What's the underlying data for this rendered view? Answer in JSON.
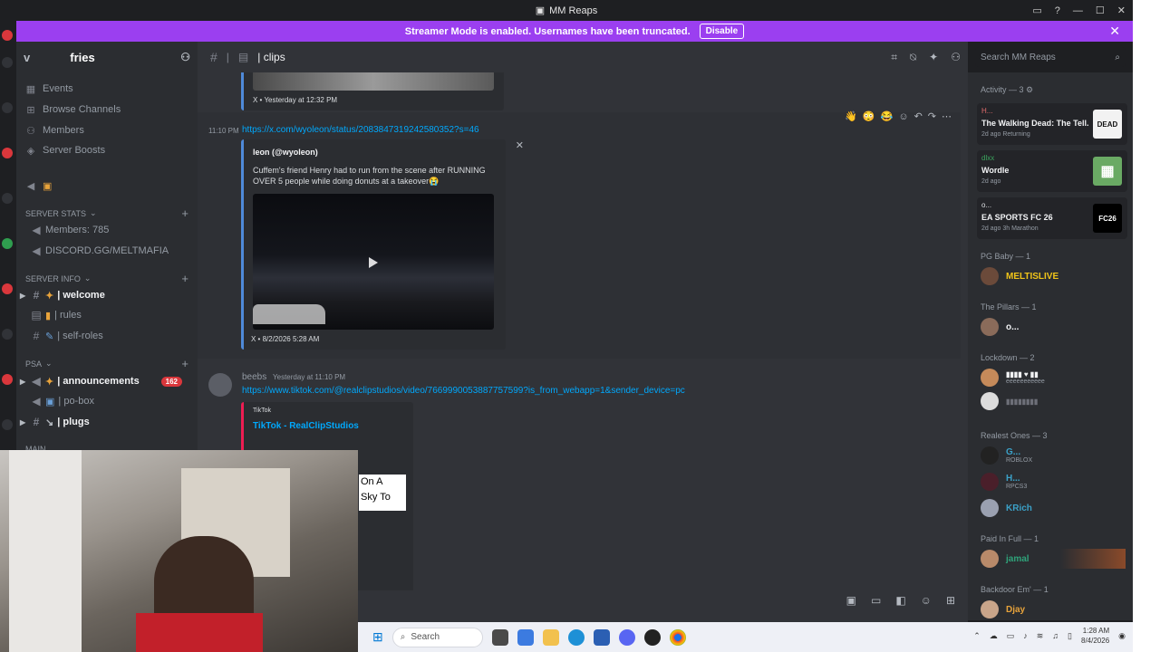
{
  "window": {
    "title": "MM Reaps"
  },
  "banner": {
    "text": "Streamer Mode is enabled. Usernames have been truncated.",
    "button": "Disable"
  },
  "server": {
    "name": "fries",
    "name_prefix": "v"
  },
  "sidebar": {
    "top_items": [
      {
        "label": "Events",
        "icon": "calendar-icon"
      },
      {
        "label": "Browse Channels",
        "icon": "browse-icon"
      },
      {
        "label": "Members",
        "icon": "members-icon"
      },
      {
        "label": "Server Boosts",
        "icon": "boost-icon"
      }
    ],
    "categories": [
      {
        "label": "SERVER STATS",
        "channels": [
          {
            "label": "Members: 785"
          },
          {
            "label": "DISCORD.GG/MELTMAFIA"
          }
        ]
      },
      {
        "label": "SERVER INFO",
        "channels": [
          {
            "label": "| welcome",
            "bright": true
          },
          {
            "label": "| rules"
          },
          {
            "label": "| self-roles"
          }
        ]
      },
      {
        "label": "PSA",
        "channels": [
          {
            "label": "| announcements",
            "bright": true,
            "badge": "162"
          },
          {
            "label": "| po-box"
          },
          {
            "label": "| plugs",
            "bright": true
          }
        ]
      },
      {
        "label": "MAIN"
      }
    ]
  },
  "channel": {
    "name": "| clips"
  },
  "search": {
    "placeholder": "Search MM Reaps"
  },
  "messages": [
    {
      "embed_footer": "X • Yesterday at 12:32 PM"
    },
    {
      "time": "11:10 PM",
      "link": "https://x.com/wyoleon/status/2083847319242580352?s=46",
      "author": "leon (@wyoleon)",
      "text": "Cuffem's friend Henry had to run from the scene after RUNNING OVER 5 people while doing donuts at a takeover😭",
      "embed_footer": "X • 8/2/2026 5:28 AM"
    },
    {
      "user": "beebs",
      "time": "Yesterday at 11:10 PM",
      "link": "https://www.tiktok.com/@realclipstudios/video/7669990053887757599?is_from_webapp=1&sender_device=pc",
      "provider": "TikTok",
      "title": "TikTok - RealClipStudios",
      "overlay": "On A\nSky To"
    }
  ],
  "reactions": [
    "👋",
    "😳",
    "😂"
  ],
  "members_panel": {
    "activity_header": "Activity — 3",
    "activities": [
      {
        "user": "H...",
        "game": "The Walking Dead: The Tell...",
        "meta": "2d ago  Returning",
        "art": "DEAD"
      },
      {
        "user": "dlxx",
        "game": "Wordle",
        "meta": "2d ago",
        "art": "▦"
      },
      {
        "user": "o...",
        "game": "EA SPORTS FC 26",
        "meta": "2d ago   3h Marathon",
        "art": "FC26"
      }
    ],
    "groups": [
      {
        "label": "PG Baby — 1",
        "members": [
          {
            "name": "MELTISLIVE",
            "color": "#f0c419"
          }
        ]
      },
      {
        "label": "The Pillars — 1",
        "members": [
          {
            "name": "o...",
            "color": "#f2f3f5"
          }
        ]
      },
      {
        "label": "Lockdown — 2",
        "members": [
          {
            "name": "",
            "sub": "eeeeeeeeeee",
            "color": "#f2f3f5"
          },
          {
            "name": "",
            "color": "#f2f3f5"
          }
        ]
      },
      {
        "label": "Realest Ones — 3",
        "members": [
          {
            "name": "G...",
            "sub": "ROBLOX",
            "color": "#3ba1c8"
          },
          {
            "name": "H...",
            "sub": "RPCS3",
            "color": "#3ba1c8"
          },
          {
            "name": "KRich",
            "color": "#3ba1c8"
          }
        ]
      },
      {
        "label": "Paid In Full — 1",
        "members": [
          {
            "name": "jamal",
            "color": "#2fa37a"
          }
        ]
      },
      {
        "label": "Backdoor Em' — 1",
        "members": [
          {
            "name": "Djay",
            "color": "#e8a33b"
          }
        ]
      }
    ]
  },
  "taskbar": {
    "search": "Search",
    "time": "1:28 AM",
    "date": "8/4/2026"
  }
}
